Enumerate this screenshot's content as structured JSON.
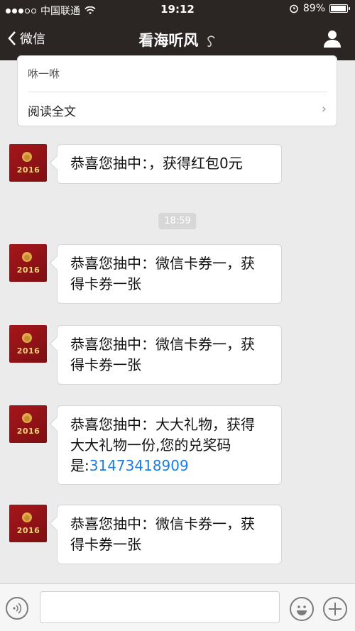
{
  "status": {
    "carrier": "中国联通",
    "time": "19:12",
    "battery": "89%",
    "battery_level": 0.89,
    "signal_bars": 3
  },
  "nav": {
    "back_label": "微信",
    "title": "看海听风"
  },
  "card": {
    "excerpt": "咻一咻",
    "read_more": "阅读全文"
  },
  "timestamp": "18:59",
  "avatar_year": "2016",
  "messages": [
    {
      "text": "恭喜您抽中：，获得红包0元"
    },
    {
      "text": "恭喜您抽中：微信卡券一，获得卡券一张"
    },
    {
      "text": "恭喜您抽中：微信卡券一，获得卡券一张"
    },
    {
      "text_prefix": "恭喜您抽中：大大礼物，获得大大礼物一份,您的兑奖码是:",
      "link": "31473418909"
    },
    {
      "text": "恭喜您抽中：微信卡券一，获得卡券一张"
    }
  ],
  "colors": {
    "nav_bg": "#2b2624",
    "chat_bg": "#ebebeb",
    "link": "#1c7ddf"
  }
}
